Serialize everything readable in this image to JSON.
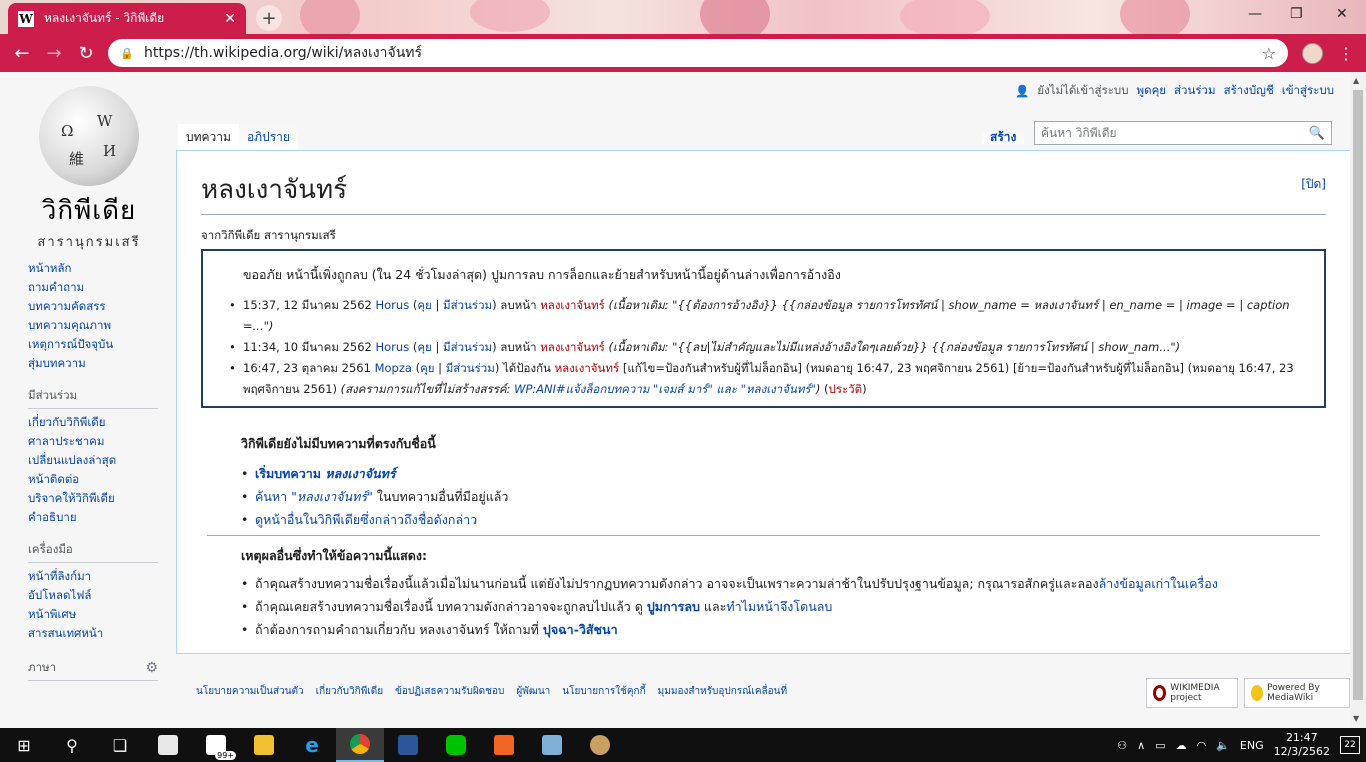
{
  "browser": {
    "tab_title": "หลงเงาจันทร์ - วิกิพีเดีย",
    "tab_close": "✕",
    "new_tab": "+",
    "url": "https://th.wikipedia.org/wiki/หลงเงาจันทร์",
    "icons": {
      "back": "back-icon",
      "forward": "forward-icon",
      "reload": "reload-icon",
      "lock": "lock-icon",
      "star": "star-icon",
      "menu": "menu-icon"
    }
  },
  "personal": {
    "not_logged_in": "ยังไม่ได้เข้าสู่ระบบ",
    "talk": "พูดคุย",
    "contributions": "ส่วนร่วม",
    "create_account": "สร้างบัญชี",
    "login": "เข้าสู่ระบบ"
  },
  "logo": {
    "name": "วิกิพีเดีย",
    "tagline": "สารานุกรมเสรี"
  },
  "tabs": {
    "article": "บทความ",
    "discussion": "อภิปราย",
    "create": "สร้าง"
  },
  "search": {
    "placeholder": "ค้นหา วิกิพีเดีย"
  },
  "sidebar": {
    "main": [
      "หน้าหลัก",
      "ถามคำถาม",
      "บทความคัดสรร",
      "บทความคุณภาพ",
      "เหตุการณ์ปัจจุบัน",
      "สุ่มบทความ"
    ],
    "participate_head": "มีส่วนร่วม",
    "participate": [
      "เกี่ยวกับวิกิพีเดีย",
      "ศาลาประชาคม",
      "เปลี่ยนแปลงล่าสุด",
      "หน้าติดต่อ",
      "บริจาคให้วิกิพีเดีย",
      "คำอธิบาย"
    ],
    "tools_head": "เครื่องมือ",
    "tools": [
      "หน้าที่ลิงก์มา",
      "อัปโหลดไฟล์",
      "หน้าพิเศษ",
      "สารสนเทศหน้า"
    ],
    "languages_head": "ภาษา"
  },
  "article": {
    "title": "หลงเงาจันทร์",
    "close": "[ปิด]",
    "from": "จากวิกิพีเดีย สารานุกรมเสรี",
    "log_intro": "ขออภัย หน้านี้เพิ่งถูกลบ (ใน 24 ชั่วโมงล่าสุด) ปูมการลบ การล็อกและย้ายสำหรับหน้านี้อยู่ด้านล่างเพื่อการอ้างอิง",
    "log": [
      {
        "time": "15:37, 12 มีนาคม 2562",
        "user": "Horus",
        "talk": "คุย",
        "contribs": "มีส่วนร่วม",
        "action": "ลบหน้า",
        "page": "หลงเงาจันทร์",
        "comment": "(เนื้อหาเดิม: \"{{ต้องการอ้างอิง}} {{กล่องข้อมูล รายการโทรทัศน์ | show_name = หลงเงาจันทร์ | en_name = | image = | caption =...\")"
      },
      {
        "time": "11:34, 10 มีนาคม 2562",
        "user": "Horus",
        "talk": "คุย",
        "contribs": "มีส่วนร่วม",
        "action": "ลบหน้า",
        "page": "หลงเงาจันทร์",
        "comment": "(เนื้อหาเดิม: \"{{ลบ|ไม่สำคัญและไม่มีแหล่งอ้างอิงใดๆเลยด้วย}} {{กล่องข้อมูล รายการโทรทัศน์ | show_nam...\")"
      },
      {
        "time": "16:47, 23 ตุลาคม 2561",
        "user": "Mopza",
        "talk": "คุย",
        "contribs": "มีส่วนร่วม",
        "action": "ได้ป้องกัน",
        "page": "หลงเงาจันทร์",
        "details": "[แก้ไข=ป้องกันสำหรับผู้ที่ไม่ล็อกอิน] (หมดอายุ 16:47, 23 พฤศจิกายน 2561) [ย้าย=ป้องกันสำหรับผู้ที่ไม่ล็อกอิน] (หมดอายุ 16:47, 23 พฤศจิกายน 2561)",
        "comment_pre": "(สงครามการแก้ไขที่ไม่สร้างสรรค์:",
        "comment_link": "WP:ANI#แจ้งล็อกบทความ \"เจมส์ มาร์\" และ \"หลงเงาจันทร์\"",
        "comment_post": ")",
        "history": "ประวัติ"
      }
    ],
    "notexist_head": "วิกิพีเดียยังไม่มีบทความที่ตรงกับชื่อนี้",
    "notexist": {
      "start_pre": "เริ่มบทความ",
      "start_name": "หลงเงาจันทร์",
      "search_pre": "ค้นหา",
      "search_name": "\"หลงเงาจันทร์\"",
      "search_post": "ในบทความอื่นที่มีอยู่แล้ว",
      "linkhere": "ดูหน้าอื่นในวิกิพีเดียซึ่งกล่าวถึงชื่อดังกล่าว"
    },
    "reasons_head": "เหตุผลอื่นซึ่งทำให้ข้อความนี้แสดง:",
    "reasons": {
      "r1_pre": "ถ้าคุณสร้างบทความชื่อเรื่องนี้แล้วเมื่อไม่นานก่อนนี้ แต่ยังไม่ปรากฏบทความดังกล่าว อาจจะเป็นเพราะความล่าช้าในปรับปรุงฐานข้อมูล; กรุณารอสักครู่และลอง",
      "r1_link": "ล้างข้อมูลเก่าในเครื่อง",
      "r2_pre": "ถ้าคุณเคยสร้างบทความชื่อเรื่องนี้ บทความดังกล่าวอาจจะถูกลบไปแล้ว ดู",
      "r2_link1": "ปูมการลบ",
      "r2_mid": "และ",
      "r2_link2": "ทำไมหน้าจึงโดนลบ",
      "r3_pre": "ถ้าต้องการถามคำถามเกี่ยวกับ หลงเงาจันทร์ ให้ถามที่",
      "r3_link": "ปุจฉา-วิสัชนา"
    }
  },
  "footer": {
    "links": [
      "นโยบายความเป็นส่วนตัว",
      "เกี่ยวกับวิกิพีเดีย",
      "ข้อปฏิเสธความรับผิดชอบ",
      "ผู้พัฒนา",
      "นโยบายการใช้คุกกี้",
      "มุมมองสำหรับอุปกรณ์เคลื่อนที่"
    ],
    "wikimedia": "WIKIMEDIA project",
    "mediawiki": "Powered By MediaWiki"
  },
  "taskbar": {
    "store_badge": "99+",
    "lang": "ENG",
    "time": "21:47",
    "date": "12/3/2562",
    "notifications": "22"
  }
}
